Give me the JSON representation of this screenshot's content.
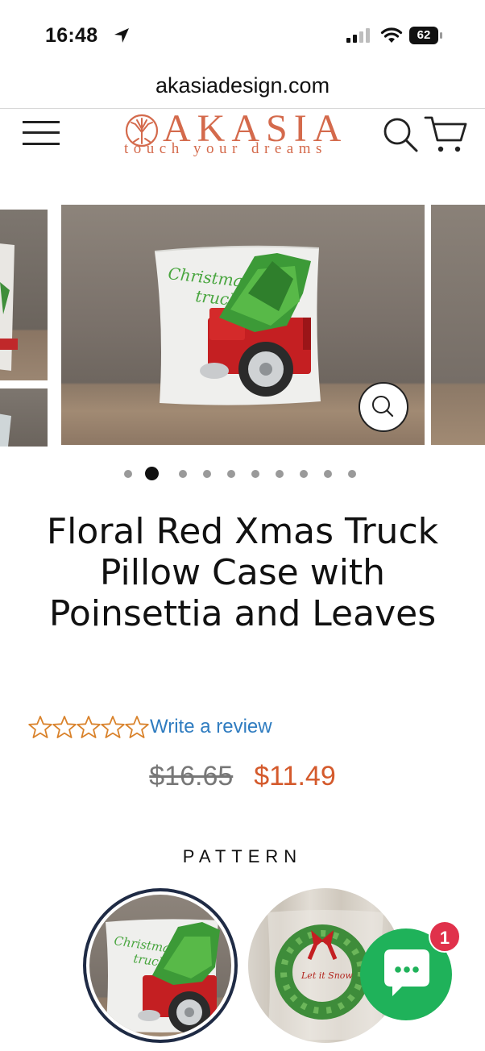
{
  "status_bar": {
    "time": "16:48",
    "battery": "62",
    "icons": [
      "location-arrow-icon",
      "cellular-signal-icon",
      "wifi-icon",
      "battery-icon"
    ]
  },
  "browser": {
    "url": "akasiadesign.com"
  },
  "header": {
    "logo_name": "AKASIA",
    "logo_tagline": "touch your dreams",
    "icons": [
      "hamburger-menu-icon",
      "tree-emblem-icon",
      "search-icon",
      "cart-icon"
    ]
  },
  "gallery": {
    "current_slide": 2,
    "slide_count": 10,
    "main_image_alt_text_on_pillow": "Christmas truck",
    "icons": [
      "zoom-icon"
    ]
  },
  "product": {
    "title": "Floral Red Xmas Truck Pillow Case with Poinsettia and Leaves",
    "rating_stars": 0,
    "rating_max": 5,
    "review_link": "Write a review",
    "price_original": "$16.65",
    "price_sale": "$11.49"
  },
  "pattern": {
    "label": "PATTERN",
    "swatch_1_text": "Christmas truck",
    "swatch_2_text": "Let it Snow"
  },
  "chat": {
    "badge_count": "1",
    "icons": [
      "chat-bubble-icon"
    ]
  },
  "colors": {
    "brand": "#d46a4c",
    "sale_price": "#d45a2c",
    "link": "#2f7cc0",
    "star_outline": "#d9822b",
    "chat_button": "#1fb25a",
    "chat_badge": "#e0314b",
    "selected_swatch_border": "#1f2b45"
  }
}
